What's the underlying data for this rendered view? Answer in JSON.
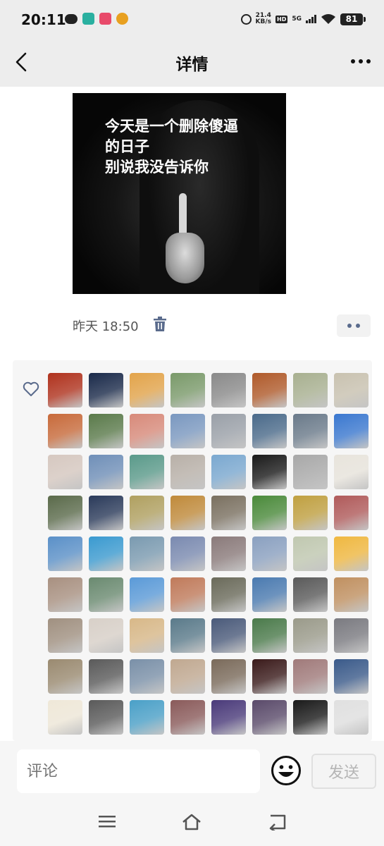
{
  "status_bar": {
    "time": "20:11",
    "network_speed_value": "21.4",
    "network_speed_unit": "KB/s",
    "hd_label": "HD",
    "signal_label": "5G",
    "battery": "81"
  },
  "nav": {
    "title": "详情",
    "back_icon": "chevron-left-icon",
    "more_icon": "more-dots-icon"
  },
  "post": {
    "image_text_line1": "今天是一个删除傻逼",
    "image_text_line2": "的日子",
    "image_text_line3": "别说我没告诉你",
    "time": "昨天 18:50"
  },
  "likes": {
    "icon": "heart-outline-icon",
    "avatar_colors": [
      "#b0321d",
      "#1a2a4a",
      "#e3a44a",
      "#7a9a6a",
      "#8a8a8a",
      "#b05a2a",
      "#a8b090",
      "#c9c2b0",
      "#c86a3a",
      "#5a7a4a",
      "#d88a7a",
      "#7a98c0",
      "#9aa0a8",
      "#4a6a8a",
      "#6a7a8a",
      "#3a78d0",
      "#d6c8c0",
      "#6f8fb8",
      "#5a9a8a",
      "#b8b0a8",
      "#7aa8d0",
      "#1a1a1a",
      "#a8a8a8",
      "#e8e4dc",
      "#5a6a4a",
      "#2a3a5a",
      "#b0a060",
      "#c08a3a",
      "#7a7060",
      "#4a8a3a",
      "#c0a040",
      "#b05a5a",
      "#5a90c8",
      "#3a9ad0",
      "#7a9ab0",
      "#7a8ab0",
      "#8a7a7a",
      "#8aa0c0",
      "#c0c8b0",
      "#f0b840",
      "#a89080",
      "#6a8a70",
      "#5a9ad8",
      "#c07a5a",
      "#6a6a5a",
      "#4a7ab0",
      "#5a5a5a",
      "#c09060",
      "#a09080",
      "#d8d0c8",
      "#d8b888",
      "#5a7a8a",
      "#4a5a7a",
      "#4a7a4a",
      "#9a9a8a",
      "#7a7a80",
      "#9a8a70",
      "#5a5a5a",
      "#7a90a8",
      "#c0a890",
      "#7a6a5a",
      "#3a1a1a",
      "#a07a7a",
      "#3a5a8a",
      "#efe8d8",
      "#5a5a5a",
      "#4aa0c8",
      "#8a5a5a",
      "#4a3a7a",
      "#5a4a6a",
      "#1a1a1a",
      "#e0e0e0"
    ]
  },
  "comment_bar": {
    "placeholder": "评论",
    "send_label": "发送",
    "emoji_icon": "emoji-smile-icon"
  },
  "system_nav": {
    "menu_icon": "menu-icon",
    "home_icon": "home-icon",
    "back_icon": "back-arrow-icon"
  }
}
